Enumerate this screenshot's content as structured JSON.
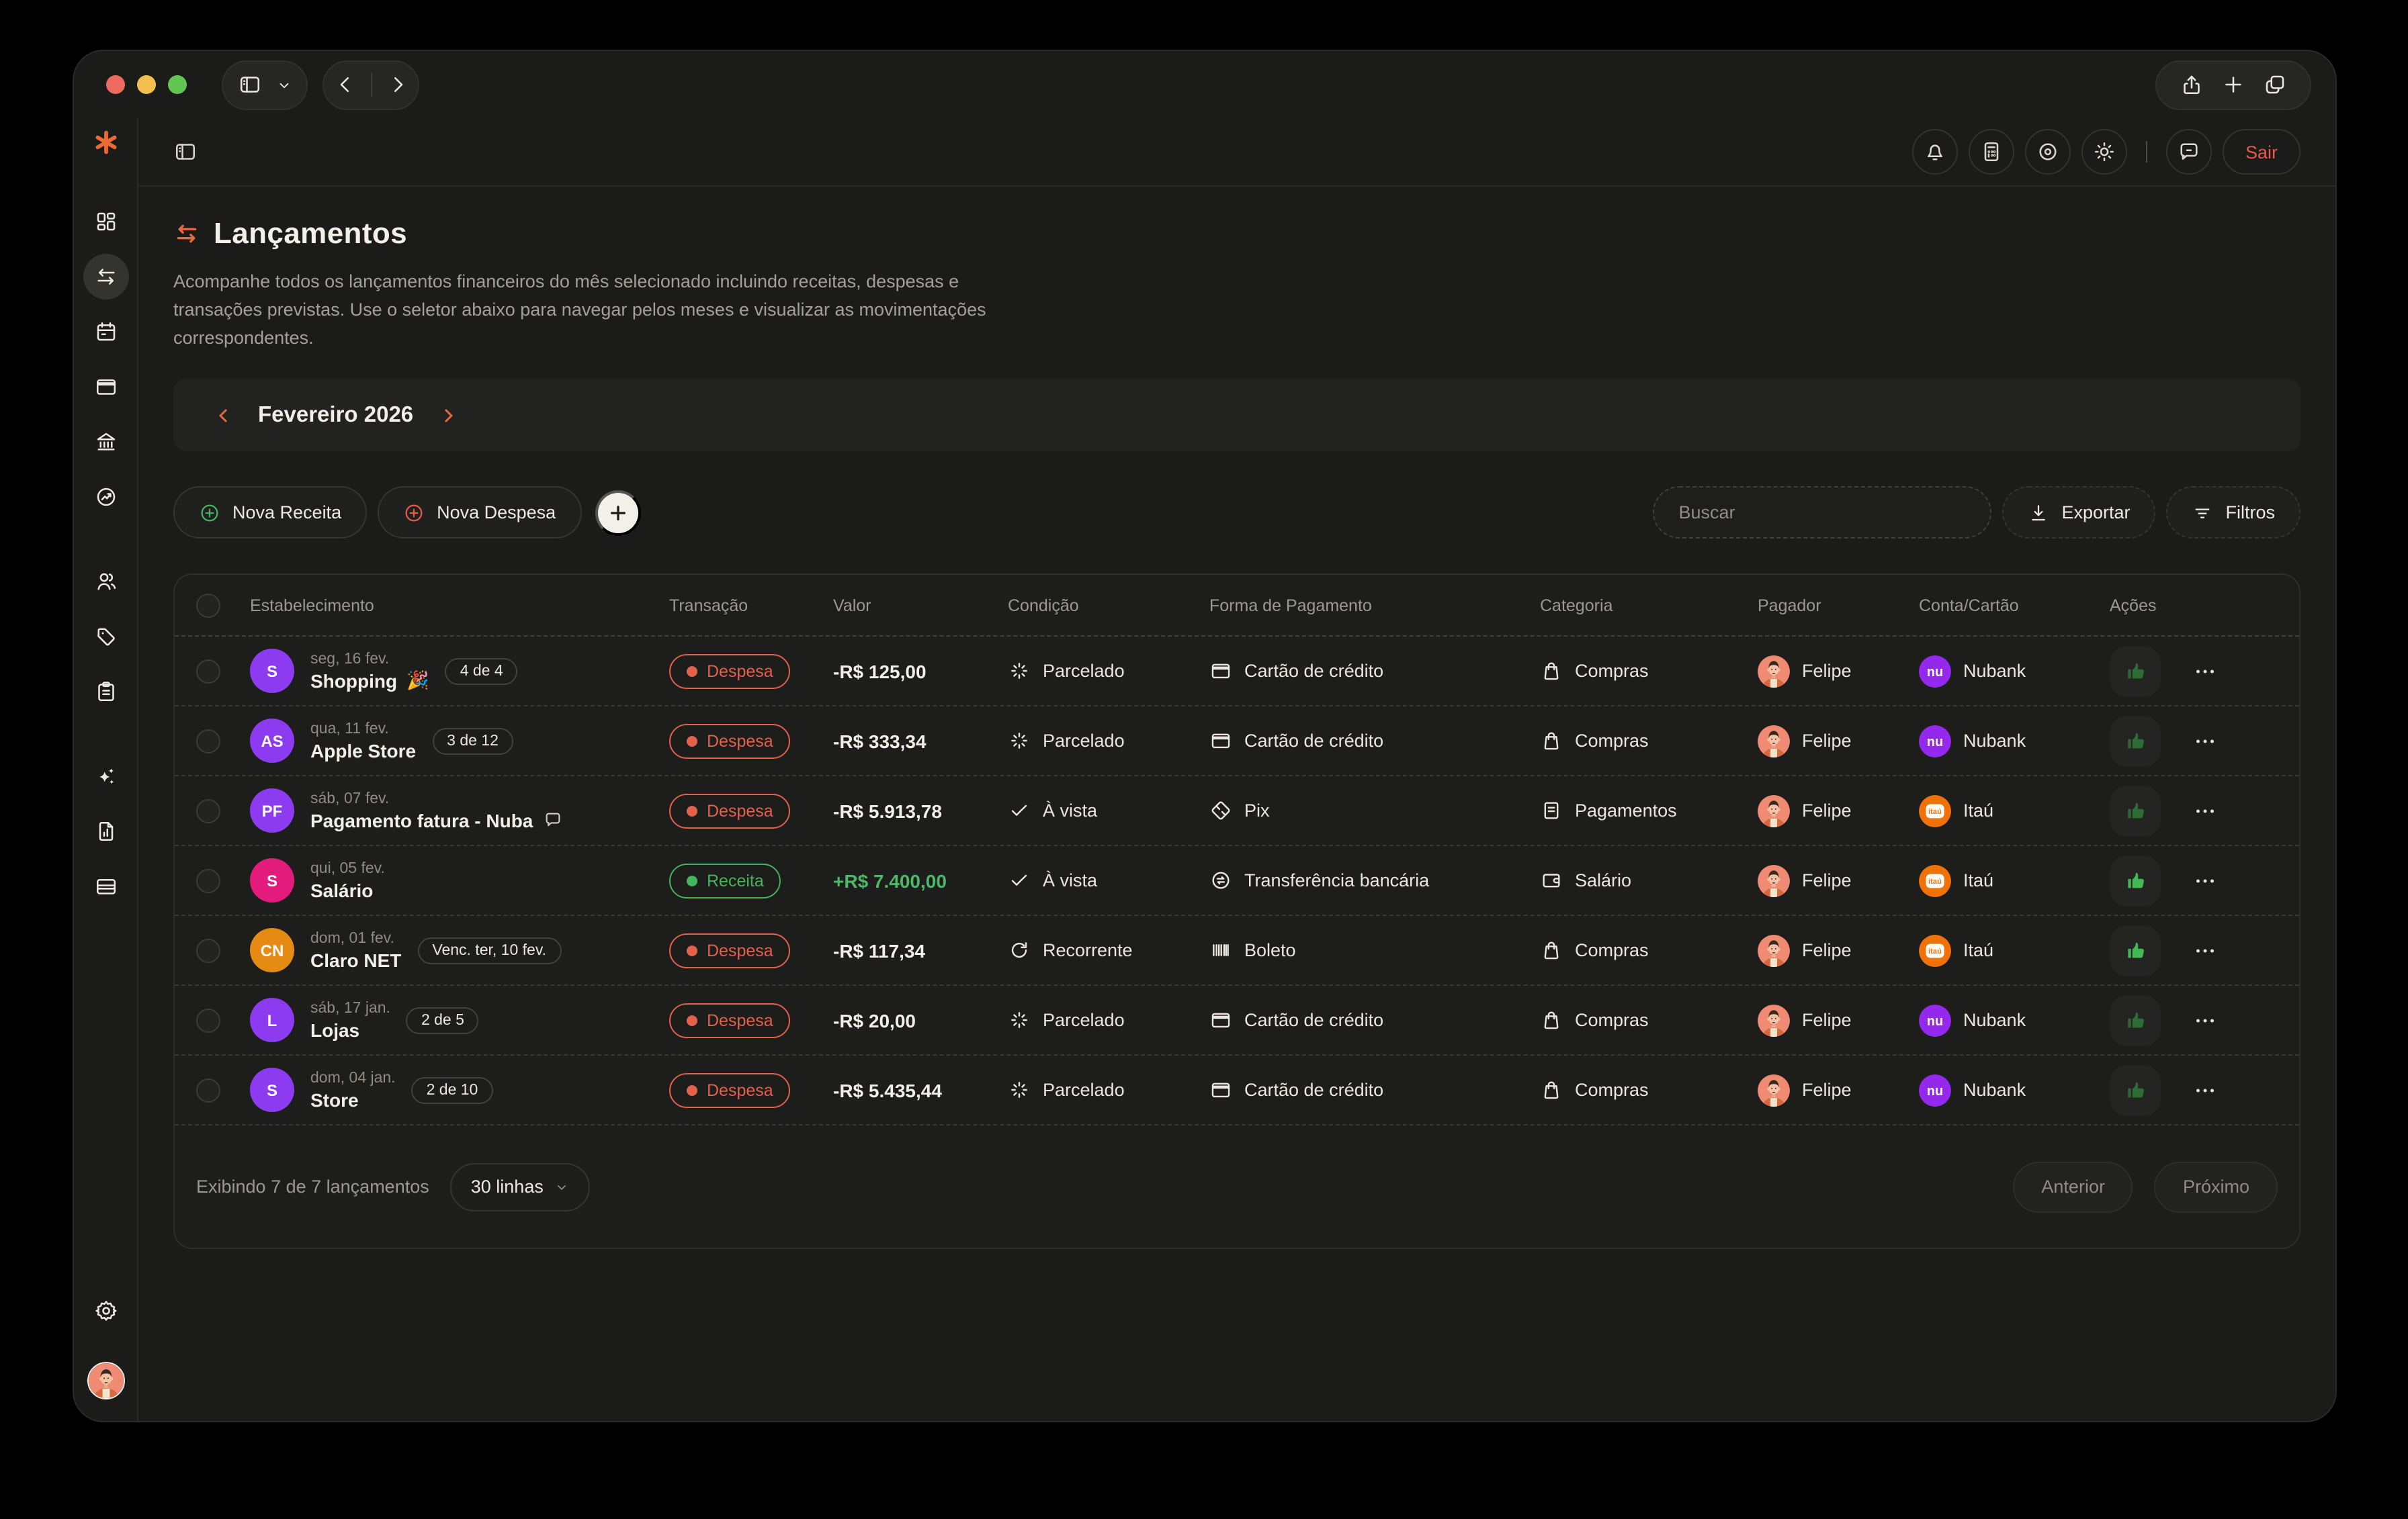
{
  "window": {
    "traffic_colors": {
      "close": "#ed6a5e",
      "minimize": "#f5bf4f",
      "zoom": "#61c554"
    },
    "toolbar_icons": [
      "sidebar-toggle-icon",
      "chevron-down-icon",
      "back-icon",
      "forward-icon",
      "share-icon",
      "new-tab-icon",
      "tab-overview-icon"
    ]
  },
  "appheader": {
    "left_icon": "panel-toggle-icon",
    "icons": [
      "bell-icon",
      "calculator-icon",
      "eye-target-icon",
      "sun-icon",
      "chat-icon"
    ],
    "logout_label": "Sair",
    "logout_color": "#e8594a"
  },
  "sidebar": {
    "logo_icon": "asterisk-logo",
    "logo_color": "#ed6a33",
    "items": [
      {
        "icon": "dashboard-grid-icon",
        "active": false
      },
      {
        "icon": "transfers-icon",
        "active": true
      },
      {
        "icon": "calendar-icon",
        "active": false
      },
      {
        "icon": "credit-card-icon",
        "active": false
      },
      {
        "icon": "bank-icon",
        "active": false
      },
      {
        "icon": "trend-circle-icon",
        "active": false
      },
      {
        "icon": "users-icon",
        "active": false
      },
      {
        "icon": "tag-icon",
        "active": false
      },
      {
        "icon": "clipboard-icon",
        "active": false
      },
      {
        "icon": "sparkles-icon",
        "active": false
      },
      {
        "icon": "report-icon",
        "active": false
      },
      {
        "icon": "wallet-card-icon",
        "active": false
      }
    ],
    "bottom_icons": [
      "gear-icon",
      "user-avatar"
    ]
  },
  "page": {
    "title": "Lançamentos",
    "title_icon_color": "#e8693f",
    "description": "Acompanhe todos os lançamentos financeiros do mês selecionado incluindo receitas, despesas e transações previstas. Use o seletor abaixo para navegar pelos meses e visualizar as movimentações correspondentes.",
    "month_selector": {
      "label": "Fevereiro 2026",
      "accent": "#e8693f"
    },
    "new_income_label": "Nova Receita",
    "new_income_color": "#43b45c",
    "new_expense_label": "Nova Despesa",
    "new_expense_color": "#e25c4a",
    "search_placeholder": "Buscar",
    "export_label": "Exportar",
    "filters_label": "Filtros"
  },
  "table": {
    "columns": [
      "Estabelecimento",
      "Transação",
      "Valor",
      "Condição",
      "Forma de Pagamento",
      "Categoria",
      "Pagador",
      "Conta/Cartão",
      "Ações"
    ],
    "rows": [
      {
        "initials": "S",
        "avatar_color": "#8d3bf0",
        "date": "seg, 16 fev.",
        "name": "Shopping",
        "emoji": "🎉",
        "badge": "4 de 4",
        "type": "Despesa",
        "type_color": "#e2604c",
        "value": "-R$ 125,00",
        "value_color": "#f2f0e9",
        "condition": "Parcelado",
        "condition_icon": "loader-icon",
        "payment": "Cartão de crédito",
        "payment_icon": "credit-card-icon",
        "category": "Compras",
        "category_icon": "shopping-bag-icon",
        "payer": "Felipe",
        "account": "Nubank",
        "account_color": "#9428ec",
        "thumb_color": "#2e6b35"
      },
      {
        "initials": "AS",
        "avatar_color": "#8d3bf0",
        "date": "qua, 11 fev.",
        "name": "Apple Store",
        "badge": "3 de 12",
        "type": "Despesa",
        "type_color": "#e2604c",
        "value": "-R$ 333,34",
        "value_color": "#f2f0e9",
        "condition": "Parcelado",
        "condition_icon": "loader-icon",
        "payment": "Cartão de crédito",
        "payment_icon": "credit-card-icon",
        "category": "Compras",
        "category_icon": "shopping-bag-icon",
        "payer": "Felipe",
        "account": "Nubank",
        "account_color": "#9428ec",
        "thumb_color": "#2e6b35"
      },
      {
        "initials": "PF",
        "avatar_color": "#8d3bf0",
        "date": "sáb, 07 fev.",
        "name": "Pagamento fatura - Nuba",
        "note_icon": "comment-icon",
        "type": "Despesa",
        "type_color": "#e2604c",
        "value": "-R$ 5.913,78",
        "value_color": "#f2f0e9",
        "condition": "À vista",
        "condition_icon": "check-icon",
        "payment": "Pix",
        "payment_icon": "pix-icon",
        "category": "Pagamentos",
        "category_icon": "doc-lines-icon",
        "payer": "Felipe",
        "account": "Itaú",
        "account_color": "#ee7208",
        "thumb_color": "#2e6b35"
      },
      {
        "initials": "S",
        "avatar_color": "#e31b7d",
        "date": "qui, 05 fev.",
        "name": "Salário",
        "type": "Receita",
        "type_color": "#43b45c",
        "value": "+R$ 7.400,00",
        "value_color": "#4cb868",
        "condition": "À vista",
        "condition_icon": "check-icon",
        "payment": "Transferência bancária",
        "payment_icon": "transfer-circle-icon",
        "category": "Salário",
        "category_icon": "wallet-icon",
        "payer": "Felipe",
        "account": "Itaú",
        "account_color": "#ee7208",
        "thumb_color": "#43b955"
      },
      {
        "initials": "CN",
        "avatar_color": "#e58a12",
        "date": "dom, 01 fev.",
        "name": "Claro NET",
        "badge": "Venc. ter, 10 fev.",
        "type": "Despesa",
        "type_color": "#e2604c",
        "value": "-R$ 117,34",
        "value_color": "#f2f0e9",
        "condition": "Recorrente",
        "condition_icon": "refresh-icon",
        "payment": "Boleto",
        "payment_icon": "barcode-icon",
        "category": "Compras",
        "category_icon": "shopping-bag-icon",
        "payer": "Felipe",
        "account": "Itaú",
        "account_color": "#ee7208",
        "thumb_color": "#43b955"
      },
      {
        "initials": "L",
        "avatar_color": "#8d3bf0",
        "date": "sáb, 17 jan.",
        "name": "Lojas",
        "badge": "2 de 5",
        "type": "Despesa",
        "type_color": "#e2604c",
        "value": "-R$ 20,00",
        "value_color": "#f2f0e9",
        "condition": "Parcelado",
        "condition_icon": "loader-icon",
        "payment": "Cartão de crédito",
        "payment_icon": "credit-card-icon",
        "category": "Compras",
        "category_icon": "shopping-bag-icon",
        "payer": "Felipe",
        "account": "Nubank",
        "account_color": "#9428ec",
        "thumb_color": "#2e6b35"
      },
      {
        "initials": "S",
        "avatar_color": "#8d3bf0",
        "date": "dom, 04 jan.",
        "name": "Store",
        "badge": "2 de 10",
        "type": "Despesa",
        "type_color": "#e2604c",
        "value": "-R$ 5.435,44",
        "value_color": "#f2f0e9",
        "condition": "Parcelado",
        "condition_icon": "loader-icon",
        "payment": "Cartão de crédito",
        "payment_icon": "credit-card-icon",
        "category": "Compras",
        "category_icon": "shopping-bag-icon",
        "payer": "Felipe",
        "account": "Nubank",
        "account_color": "#9428ec",
        "thumb_color": "#2e6b35"
      }
    ],
    "footer": {
      "summary": "Exibindo 7 de 7 lançamentos",
      "rows_per_page": "30 linhas",
      "prev_label": "Anterior",
      "next_label": "Próximo"
    }
  },
  "brands": {
    "nubank_glyph": "nu",
    "itau_glyph": "itaú"
  }
}
